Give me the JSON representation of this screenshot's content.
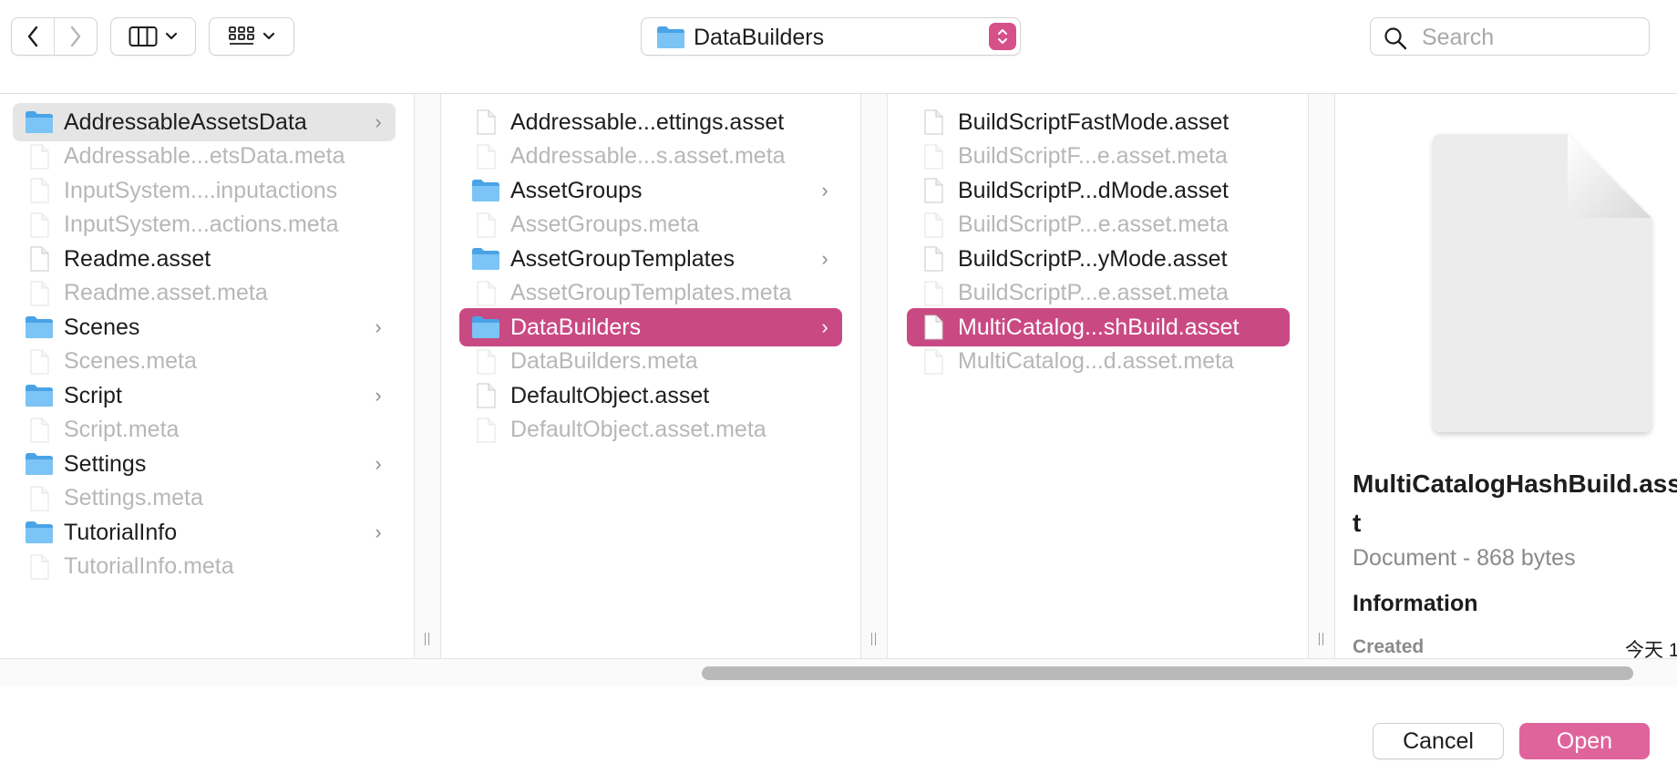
{
  "toolbar": {
    "path_label": "DataBuilders",
    "search_placeholder": "Search"
  },
  "columns": {
    "col1": [
      {
        "label": "AddressableAssetsData",
        "type": "folder",
        "state": "hover",
        "dim": false
      },
      {
        "label": "Addressable...etsData.meta",
        "type": "file",
        "dim": true
      },
      {
        "label": "InputSystem....inputactions",
        "type": "file",
        "dim": true
      },
      {
        "label": "InputSystem...actions.meta",
        "type": "file",
        "dim": true
      },
      {
        "label": "Readme.asset",
        "type": "file",
        "dim": false
      },
      {
        "label": "Readme.asset.meta",
        "type": "file",
        "dim": true
      },
      {
        "label": "Scenes",
        "type": "folder",
        "dim": false
      },
      {
        "label": "Scenes.meta",
        "type": "file",
        "dim": true
      },
      {
        "label": "Script",
        "type": "folder",
        "dim": false
      },
      {
        "label": "Script.meta",
        "type": "file",
        "dim": true
      },
      {
        "label": "Settings",
        "type": "folder",
        "dim": false
      },
      {
        "label": "Settings.meta",
        "type": "file",
        "dim": true
      },
      {
        "label": "TutorialInfo",
        "type": "folder",
        "dim": false
      },
      {
        "label": "TutorialInfo.meta",
        "type": "file",
        "dim": true
      }
    ],
    "col2": [
      {
        "label": "Addressable...ettings.asset",
        "type": "file",
        "dim": false
      },
      {
        "label": "Addressable...s.asset.meta",
        "type": "file",
        "dim": true
      },
      {
        "label": "AssetGroups",
        "type": "folder",
        "dim": false
      },
      {
        "label": "AssetGroups.meta",
        "type": "file",
        "dim": true
      },
      {
        "label": "AssetGroupTemplates",
        "type": "folder",
        "dim": false
      },
      {
        "label": "AssetGroupTemplates.meta",
        "type": "file",
        "dim": true
      },
      {
        "label": "DataBuilders",
        "type": "folder",
        "state": "selected",
        "dim": false
      },
      {
        "label": "DataBuilders.meta",
        "type": "file",
        "dim": true
      },
      {
        "label": "DefaultObject.asset",
        "type": "file",
        "dim": false
      },
      {
        "label": "DefaultObject.asset.meta",
        "type": "file",
        "dim": true
      }
    ],
    "col3": [
      {
        "label": "BuildScriptFastMode.asset",
        "type": "file",
        "dim": false
      },
      {
        "label": "BuildScriptF...e.asset.meta",
        "type": "file",
        "dim": true
      },
      {
        "label": "BuildScriptP...dMode.asset",
        "type": "file",
        "dim": false
      },
      {
        "label": "BuildScriptP...e.asset.meta",
        "type": "file",
        "dim": true
      },
      {
        "label": "BuildScriptP...yMode.asset",
        "type": "file",
        "dim": false
      },
      {
        "label": "BuildScriptP...e.asset.meta",
        "type": "file",
        "dim": true
      },
      {
        "label": "MultiCatalog...shBuild.asset",
        "type": "file",
        "state": "selected",
        "dim": false
      },
      {
        "label": "MultiCatalog...d.asset.meta",
        "type": "file",
        "dim": true
      }
    ]
  },
  "preview": {
    "name": "MultiCatalogHashBuild.asset",
    "kind": "Document - 868 bytes",
    "info_header": "Information",
    "created_label": "Created",
    "created_value": "今天 1"
  },
  "buttons": {
    "cancel": "Cancel",
    "open": "Open"
  },
  "colors": {
    "accent": "#c94a83",
    "open_button": "#e0649c",
    "folder_blue": "#5fb3f0"
  }
}
